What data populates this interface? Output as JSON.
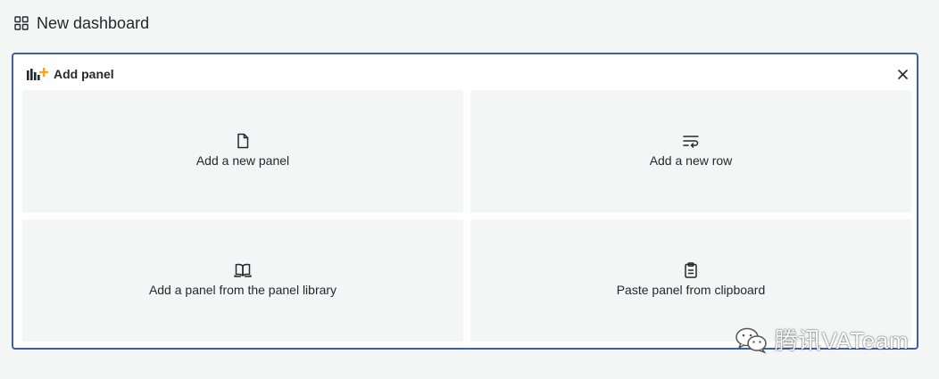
{
  "dashboard": {
    "title": "New dashboard",
    "icon": "dashboard-grid-icon"
  },
  "add_panel": {
    "title": "Add panel",
    "title_icon": "add-chart-icon",
    "close_icon": "close-icon",
    "accent_color": "#3d5ea8",
    "options": [
      {
        "label": "Add a new panel",
        "icon": "file-icon"
      },
      {
        "label": "Add a new row",
        "icon": "row-wrap-icon"
      },
      {
        "label": "Add a panel from the panel library",
        "icon": "book-icon"
      },
      {
        "label": "Paste panel from clipboard",
        "icon": "clipboard-icon"
      }
    ]
  },
  "watermark": {
    "text": "腾讯VATeam",
    "icon": "wechat-icon"
  }
}
